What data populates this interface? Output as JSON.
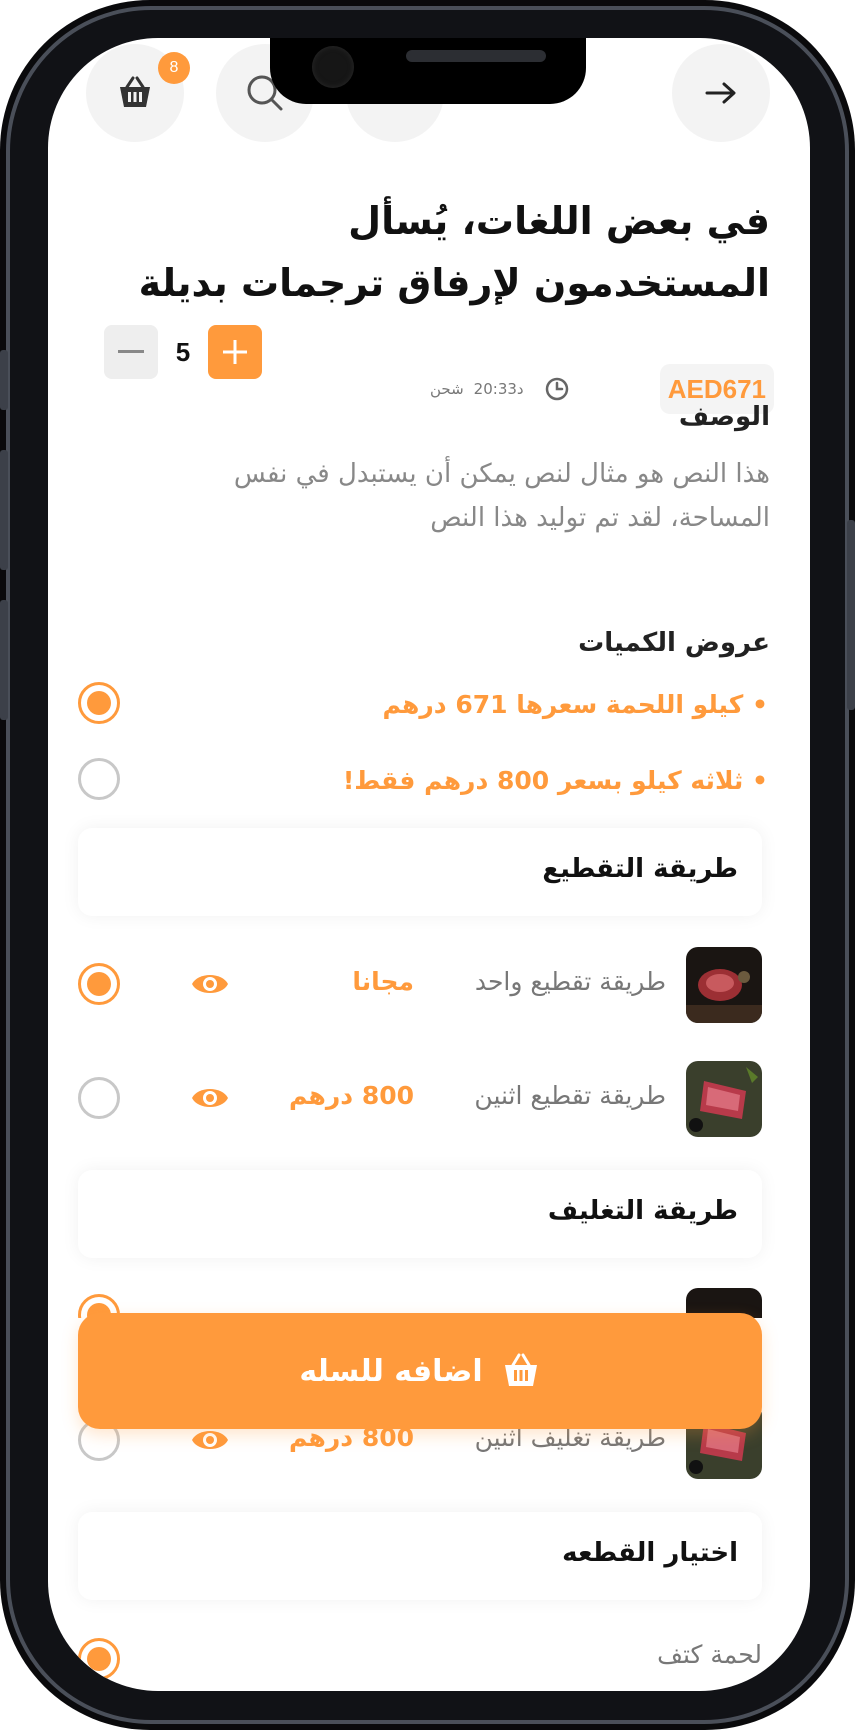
{
  "header": {
    "cart_count": "8"
  },
  "product": {
    "title": "في بعض اللغات، يُسأل المستخدمون لإرفاق ترجمات بديلة",
    "price": "AED671",
    "shipping_time": "20:33د",
    "shipping_label": "شحن",
    "quantity": "5"
  },
  "description": {
    "heading": "الوصف",
    "text": "هذا النص هو مثال لنص يمكن أن يستبدل في نفس المساحة، لقد تم توليد هذا النص"
  },
  "quantity_offers": {
    "heading": "عروض الكميات",
    "items": [
      {
        "label": "كيلو اللحمة سعرها 671 درهم",
        "selected": true
      },
      {
        "label": "ثلاثه كيلو بسعر 800 درهم فقط!",
        "selected": false
      }
    ]
  },
  "cutting": {
    "heading": "طريقة التقطيع",
    "options": [
      {
        "name": "طريقة تقطيع واحد",
        "price": "مجانا",
        "selected": true
      },
      {
        "name": "طريقة تقطيع اثنين",
        "price": "800 درهم",
        "selected": false
      }
    ]
  },
  "packaging": {
    "heading": "طريقة التغليف",
    "options": [
      {
        "name": "طريقة تغليف اثنين",
        "price": "800 درهم",
        "selected": false
      }
    ]
  },
  "piece": {
    "heading": "اختيار القطعه",
    "options": [
      {
        "name": "لحمة كتف",
        "selected": true
      }
    ]
  },
  "add_to_cart": {
    "label": "اضافه للسله"
  },
  "colors": {
    "accent": "#ff9a3c",
    "frame": "#0a0a0c"
  }
}
